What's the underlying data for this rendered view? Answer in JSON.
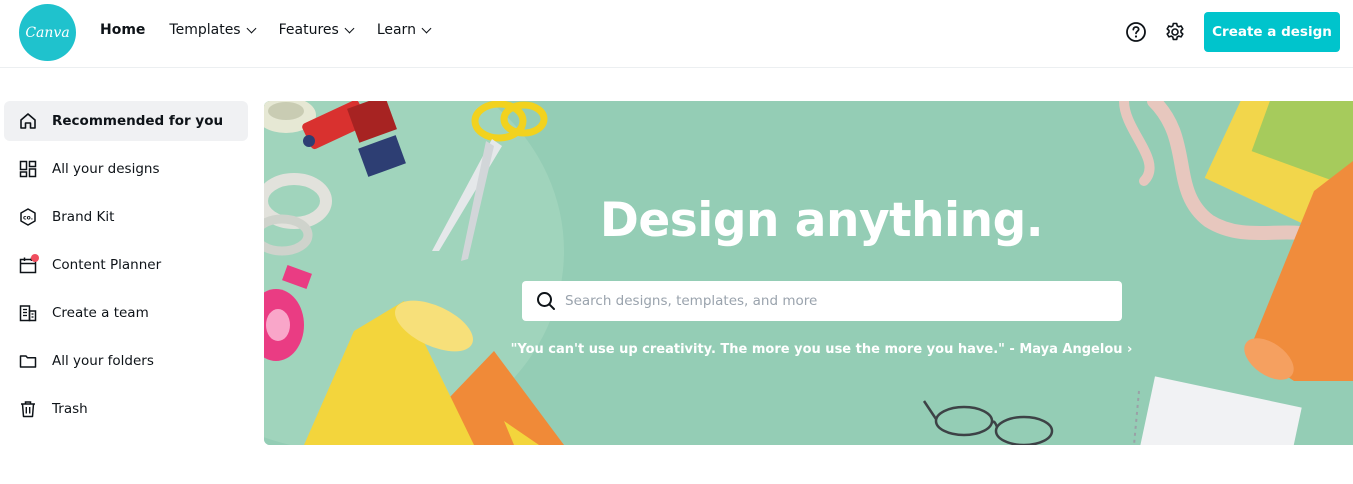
{
  "header": {
    "logo_text": "Canva",
    "nav": [
      {
        "label": "Home"
      },
      {
        "label": "Templates"
      },
      {
        "label": "Features"
      },
      {
        "label": "Learn"
      }
    ],
    "create_button": "Create a design",
    "icons": [
      "help-icon",
      "gear-icon"
    ]
  },
  "sidebar": {
    "items": [
      {
        "label": "Recommended for you",
        "icon": "home-icon"
      },
      {
        "label": "All your designs",
        "icon": "grid-icon"
      },
      {
        "label": "Brand Kit",
        "icon": "brand-kit-icon"
      },
      {
        "label": "Content Planner",
        "icon": "calendar-icon"
      },
      {
        "label": "Create a team",
        "icon": "building-icon"
      },
      {
        "label": "All your folders",
        "icon": "folder-icon"
      },
      {
        "label": "Trash",
        "icon": "trash-icon"
      }
    ]
  },
  "hero": {
    "title": "Design anything.",
    "search_placeholder": "Search designs, templates, and more",
    "search_value": "",
    "quote": "\"You can't use up creativity. The more you use the more you have.\" - Maya Angelou ›"
  },
  "colors": {
    "accent": "#00c4cc",
    "hero_bg": "#94cdb5",
    "notification": "#f04e5e"
  }
}
